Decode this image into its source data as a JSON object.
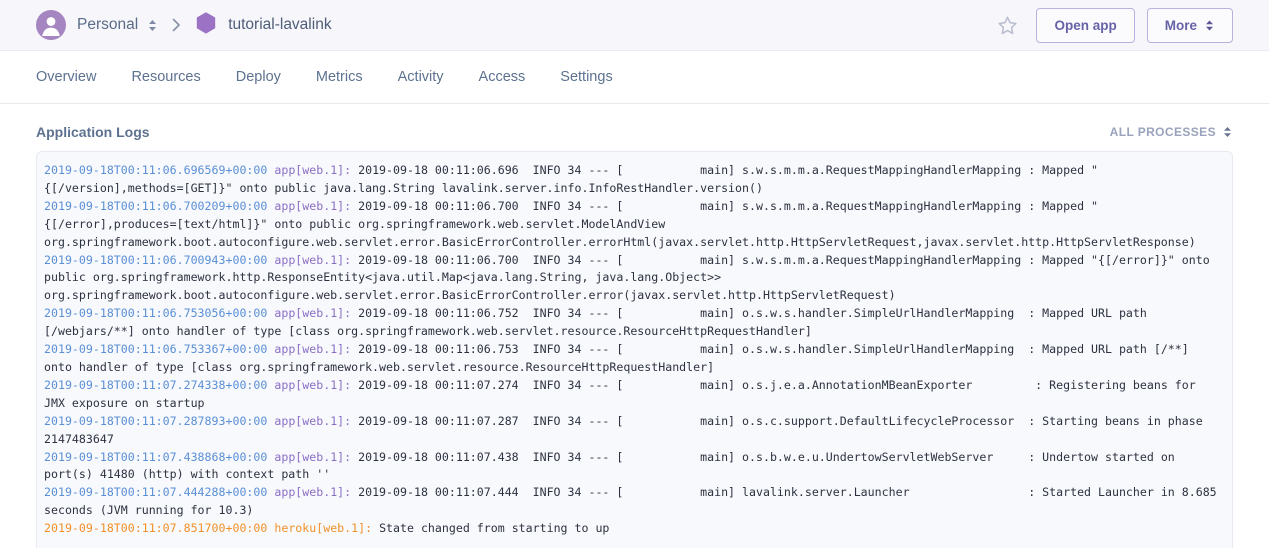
{
  "topbar": {
    "account_name": "Personal",
    "account_chevron_icon": "up-down-chevron-icon",
    "separator": "›",
    "app_name": "tutorial-lavalink",
    "favorite_icon": "star-icon",
    "open_app_label": "Open app",
    "more_label": "More",
    "more_chevron_icon": "up-down-chevron-icon",
    "avatar_icon": "user-avatar-icon",
    "app_icon": "hexagon-icon"
  },
  "nav": {
    "tabs": [
      {
        "label": "Overview"
      },
      {
        "label": "Resources"
      },
      {
        "label": "Deploy"
      },
      {
        "label": "Metrics"
      },
      {
        "label": "Activity"
      },
      {
        "label": "Access"
      },
      {
        "label": "Settings"
      }
    ]
  },
  "section": {
    "title": "Application Logs",
    "process_filter_label": "ALL PROCESSES",
    "process_filter_icon": "up-down-chevron-icon"
  },
  "colors": {
    "timestamp_app": "#5a8fd6",
    "source_app": "#8b6fc4",
    "timestamp_heroku": "#f1902a",
    "source_heroku": "#f1902a",
    "body_text": "#2c3240",
    "accent": "#6762a6",
    "panel_bg": "#f8f9fc"
  },
  "logs": {
    "entries": [
      {
        "timestamp": "2019-09-18T00:11:06.696569+00:00",
        "source": "app[web.1]:",
        "type": "app",
        "message": " 2019-09-18 00:11:06.696  INFO 34 --- [           main] s.w.s.m.m.a.RequestMappingHandlerMapping : Mapped \"{[/version],methods=[GET]}\" onto public java.lang.String lavalink.server.info.InfoRestHandler.version()"
      },
      {
        "timestamp": "2019-09-18T00:11:06.700209+00:00",
        "source": "app[web.1]:",
        "type": "app",
        "message": " 2019-09-18 00:11:06.700  INFO 34 --- [           main] s.w.s.m.m.a.RequestMappingHandlerMapping : Mapped \"{[/error],produces=[text/html]}\" onto public org.springframework.web.servlet.ModelAndView org.springframework.boot.autoconfigure.web.servlet.error.BasicErrorController.errorHtml(javax.servlet.http.HttpServletRequest,javax.servlet.http.HttpServletResponse)"
      },
      {
        "timestamp": "2019-09-18T00:11:06.700943+00:00",
        "source": "app[web.1]:",
        "type": "app",
        "message": " 2019-09-18 00:11:06.700  INFO 34 --- [           main] s.w.s.m.m.a.RequestMappingHandlerMapping : Mapped \"{[/error]}\" onto public org.springframework.http.ResponseEntity<java.util.Map<java.lang.String, java.lang.Object>> org.springframework.boot.autoconfigure.web.servlet.error.BasicErrorController.error(javax.servlet.http.HttpServletRequest)"
      },
      {
        "timestamp": "2019-09-18T00:11:06.753056+00:00",
        "source": "app[web.1]:",
        "type": "app",
        "message": " 2019-09-18 00:11:06.752  INFO 34 --- [           main] o.s.w.s.handler.SimpleUrlHandlerMapping  : Mapped URL path [/webjars/**] onto handler of type [class org.springframework.web.servlet.resource.ResourceHttpRequestHandler]"
      },
      {
        "timestamp": "2019-09-18T00:11:06.753367+00:00",
        "source": "app[web.1]:",
        "type": "app",
        "message": " 2019-09-18 00:11:06.753  INFO 34 --- [           main] o.s.w.s.handler.SimpleUrlHandlerMapping  : Mapped URL path [/**] onto handler of type [class org.springframework.web.servlet.resource.ResourceHttpRequestHandler]"
      },
      {
        "timestamp": "2019-09-18T00:11:07.274338+00:00",
        "source": "app[web.1]:",
        "type": "app",
        "message": " 2019-09-18 00:11:07.274  INFO 34 --- [           main] o.s.j.e.a.AnnotationMBeanExporter         : Registering beans for JMX exposure on startup"
      },
      {
        "timestamp": "2019-09-18T00:11:07.287893+00:00",
        "source": "app[web.1]:",
        "type": "app",
        "message": " 2019-09-18 00:11:07.287  INFO 34 --- [           main] o.s.c.support.DefaultLifecycleProcessor  : Starting beans in phase 2147483647"
      },
      {
        "timestamp": "2019-09-18T00:11:07.438868+00:00",
        "source": "app[web.1]:",
        "type": "app",
        "message": " 2019-09-18 00:11:07.438  INFO 34 --- [           main] o.s.b.w.e.u.UndertowServletWebServer     : Undertow started on port(s) 41480 (http) with context path ''"
      },
      {
        "timestamp": "2019-09-18T00:11:07.444288+00:00",
        "source": "app[web.1]:",
        "type": "app",
        "message": " 2019-09-18 00:11:07.444  INFO 34 --- [           main] lavalink.server.Launcher                 : Started Launcher in 8.685 seconds (JVM running for 10.3)"
      },
      {
        "timestamp": "2019-09-18T00:11:07.851700+00:00",
        "source": "heroku[web.1]:",
        "type": "heroku",
        "message": " State changed from starting to up"
      }
    ]
  }
}
